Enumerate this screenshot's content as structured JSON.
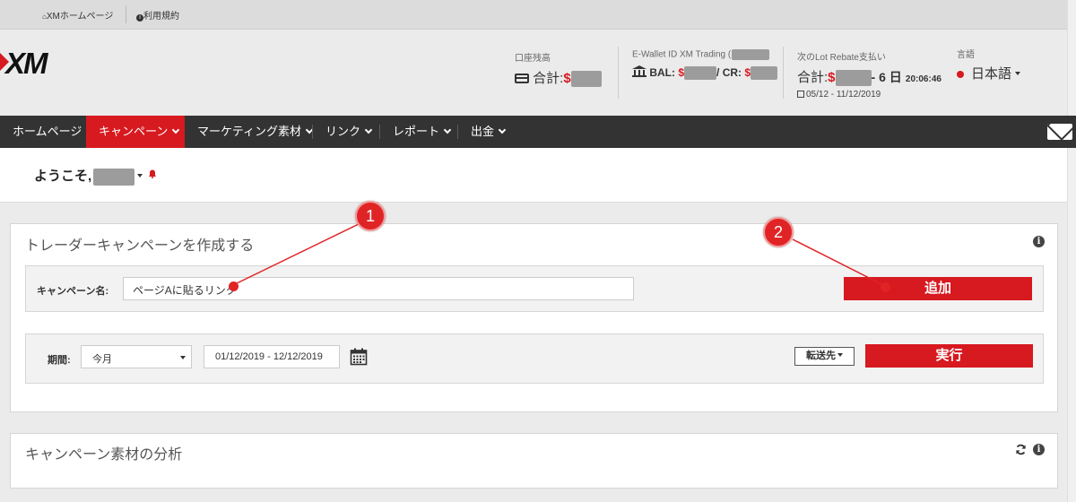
{
  "topbar": {
    "home_link": "XMホームページ",
    "terms_link": "利用規約"
  },
  "logo": {
    "text": "XM"
  },
  "header": {
    "balance": {
      "label": "口座残高",
      "prefix": "合計:",
      "currency": "$"
    },
    "ewallet": {
      "label": "E-Wallet ID XM Trading (",
      "bal_prefix": "BAL: ",
      "currency": "$",
      "cr_prefix": "/ CR: "
    },
    "rebate": {
      "label": "次のLot Rebate支払い",
      "prefix": "合計:",
      "currency": "$",
      "countdown_days": "- 6 日",
      "countdown_time": "20:06:46",
      "period": "05/12 - 11/12/2019"
    },
    "language": {
      "label": "言語",
      "value": "日本語"
    }
  },
  "nav": {
    "items": [
      {
        "label": "ホームページ"
      },
      {
        "label": "キャンペーン"
      },
      {
        "label": "マーケティング素材"
      },
      {
        "label": "リンク"
      },
      {
        "label": "レポート"
      },
      {
        "label": "出金"
      }
    ]
  },
  "welcome": {
    "text": "ようこそ,"
  },
  "campaign_panel": {
    "title": "トレーダーキャンペーンを作成する",
    "name_label": "キャンペーン名:",
    "name_value": "ページAに貼るリンク",
    "add_button": "追加",
    "period_label": "期間:",
    "period_select": "今月",
    "date_range": "01/12/2019 - 12/12/2019",
    "forward_button": "転送先",
    "run_button": "実行"
  },
  "analysis_panel": {
    "title": "キャンペーン素材の分析"
  },
  "callouts": {
    "one": "1",
    "two": "2"
  },
  "colors": {
    "brand_red": "#d71920",
    "nav_bg": "#333333",
    "callout_red": "#e02426"
  }
}
